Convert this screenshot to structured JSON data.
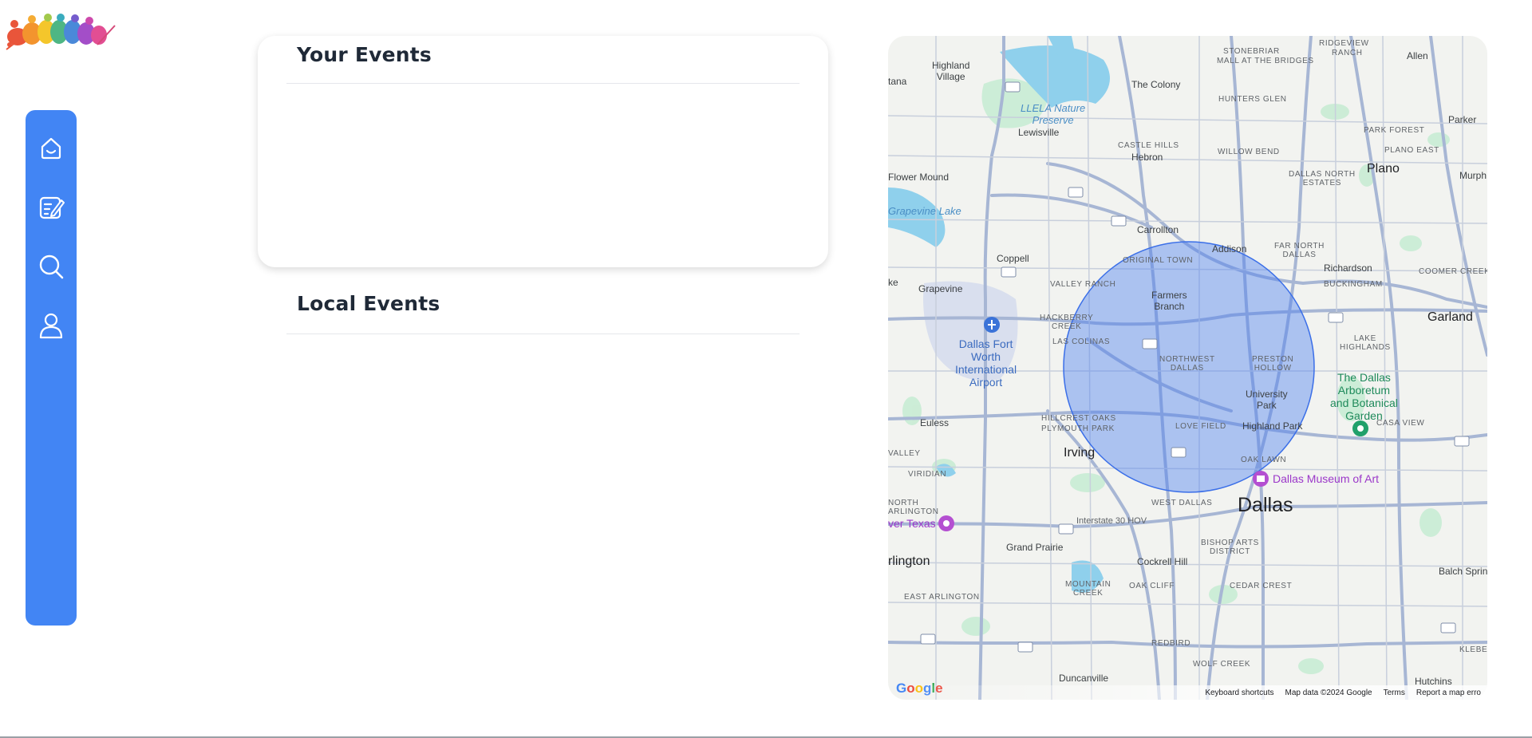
{
  "logo": {
    "alt": "sports-silhouettes-logo"
  },
  "sidebar": {
    "items": [
      {
        "name": "home",
        "icon": "home-icon"
      },
      {
        "name": "create-event",
        "icon": "edit-note-icon"
      },
      {
        "name": "search",
        "icon": "search-icon"
      },
      {
        "name": "profile",
        "icon": "user-icon"
      }
    ],
    "color": "#4285f4"
  },
  "your_events": {
    "title": "Your Events",
    "items": []
  },
  "local_events": {
    "title": "Local Events",
    "items": []
  },
  "map": {
    "search_radius_color": "#4285f4",
    "labels": {
      "stonebriar": "STONEBRIAR",
      "mall_at_the_bridges": "MALL AT THE BRIDGES",
      "ridgeview_ranch": "RIDGEVIEW",
      "ranch": "RANCH",
      "allen": "Allen",
      "highland_village": "Highland\nVillage",
      "the_colony": "The Colony",
      "hunters_glen": "HUNTERS GLEN",
      "llela": "LLELA Nature\nPreserve",
      "parker": "Parker",
      "lewisville": "Lewisville",
      "park_forest": "PARK FOREST",
      "castle_hills": "CASTLE HILLS",
      "hebron": "Hebron",
      "willow_bend": "WILLOW BEND",
      "plano_east": "PLANO EAST",
      "flower_mound": "Flower Mound",
      "dallas_north_estates": "DALLAS NORTH\nESTATES",
      "plano": "Plano",
      "murphy": "Murph",
      "grapevine_lake": "Grapevine Lake",
      "carrollton": "Carrollton",
      "addison": "Addison",
      "far_north_dallas": "FAR NORTH\nDALLAS",
      "coppell": "Coppell",
      "original_town": "ORIGINAL TOWN",
      "richardson": "Richardson",
      "coomer_creek": "COOMER CREEK",
      "buckingham": "BUCKINGHAM",
      "grapevine": "Grapevine",
      "valley_ranch": "VALLEY RANCH",
      "farmers_branch": "Farmers\nBranch",
      "garland": "Garland",
      "hackberry_creek": "HACKBERRY\nCREEK",
      "lake_highlands": "LAKE\nHIGHLANDS",
      "las_colinas": "LAS COLINAS",
      "dfw_airport": "Dallas Fort\nWorth\nInternational\nAirport",
      "northwest_dallas": "NORTHWEST\nDALLAS",
      "preston_hollow": "PRESTON\nHOLLOW",
      "arboretum": "The Dallas\nArboretum\nand Botanical\nGarden",
      "university_park": "University\nPark",
      "euless": "Euless",
      "hillcrest_oaks": "HILLCREST OAKS",
      "plymouth_park": "PLYMOUTH PARK",
      "love_field": "LOVE FIELD",
      "highland_park": "Highland Park",
      "casa_view": "CASA VIEW",
      "valley": "VALLEY",
      "irving": "Irving",
      "oak_lawn": "OAK LAWN",
      "dallas_museum": "Dallas Museum of Art",
      "viridian": "VIRIDIAN",
      "west_dallas": "WEST DALLAS",
      "dallas": "Dallas",
      "north_arlington": "NORTH\nARLINGTON",
      "river_texas": "ver Texas",
      "interstate_30": "Interstate 30 HOV",
      "grand_prairie": "Grand Prairie",
      "bishop_arts": "BISHOP ARTS\nDISTRICT",
      "arlington": "rlington",
      "cockrell_hill": "Cockrell Hill",
      "balch_springs": "Balch Sprin",
      "mountain_creek": "MOUNTAIN\nCREEK",
      "oak_cliff": "OAK CLIFF",
      "cedar_crest": "CEDAR CREST",
      "east_arlington": "EAST ARLINGTON",
      "redbird": "REDBIRD",
      "kleberg": "KLEBER",
      "wolf_creek": "WOLF CREEK",
      "duncanville": "Duncanville",
      "hutchins": "Hutchins",
      "tana": "tana",
      "ke": "ke"
    },
    "footer": {
      "keyboard": "Keyboard shortcuts",
      "map_data": "Map data ©2024 Google",
      "terms": "Terms",
      "report": "Report a map erro"
    },
    "google_logo": "Google"
  }
}
